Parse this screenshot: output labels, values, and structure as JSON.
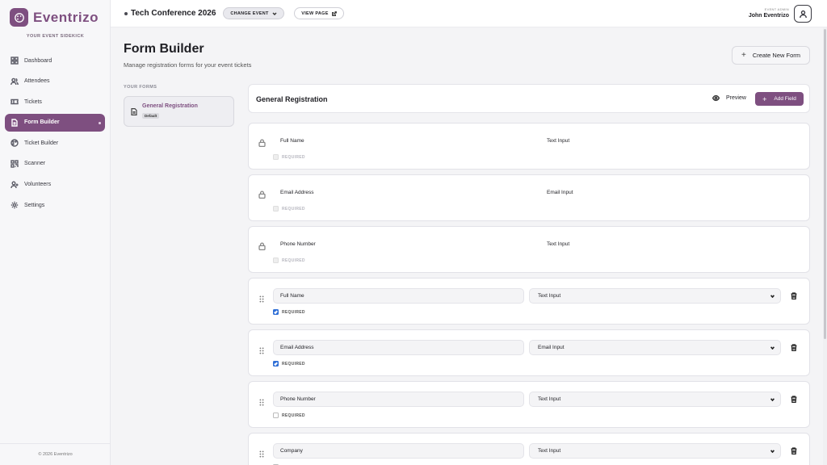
{
  "brand": {
    "name": "Eventrizo",
    "tagline": "YOUR EVENT SIDEKICK",
    "accent": "#7e4f80"
  },
  "sidebar": {
    "items": [
      {
        "label": "Dashboard",
        "icon": "grid-icon"
      },
      {
        "label": "Attendees",
        "icon": "users-icon"
      },
      {
        "label": "Tickets",
        "icon": "ticket-icon"
      },
      {
        "label": "Form Builder",
        "icon": "document-icon",
        "active": true
      },
      {
        "label": "Ticket Builder",
        "icon": "palette-icon"
      },
      {
        "label": "Scanner",
        "icon": "scan-icon"
      },
      {
        "label": "Volunteers",
        "icon": "user-plus-icon"
      },
      {
        "label": "Settings",
        "icon": "gear-icon"
      }
    ],
    "footer": "© 2026 Eventrizo"
  },
  "topbar": {
    "event_title": "Tech Conference 2026",
    "change_event": "CHANGE EVENT",
    "view_page": "VIEW PAGE",
    "admin_role": "EVENT ADMIN",
    "admin_name": "John Eventrizo"
  },
  "page": {
    "title": "Form Builder",
    "subtitle": "Manage registration forms for your event tickets",
    "create_button": "Create New Form"
  },
  "forms_panel": {
    "label": "YOUR FORMS",
    "forms": [
      {
        "name": "General Registration",
        "badge": "Default"
      }
    ]
  },
  "builder": {
    "title": "General Registration",
    "preview_label": "Preview",
    "add_field_label": "Add Field",
    "required_label": "REQUIRED",
    "locked_fields": [
      {
        "label": "Full Name",
        "type": "Text Input"
      },
      {
        "label": "Email Address",
        "type": "Email Input"
      },
      {
        "label": "Phone Number",
        "type": "Text Input"
      }
    ],
    "editable_fields": [
      {
        "label": "Full Name",
        "type": "Text Input",
        "required": true
      },
      {
        "label": "Email Address",
        "type": "Email Input",
        "required": true
      },
      {
        "label": "Phone Number",
        "type": "Text Input",
        "required": false
      },
      {
        "label": "Company",
        "type": "Text Input",
        "required": false
      }
    ]
  }
}
